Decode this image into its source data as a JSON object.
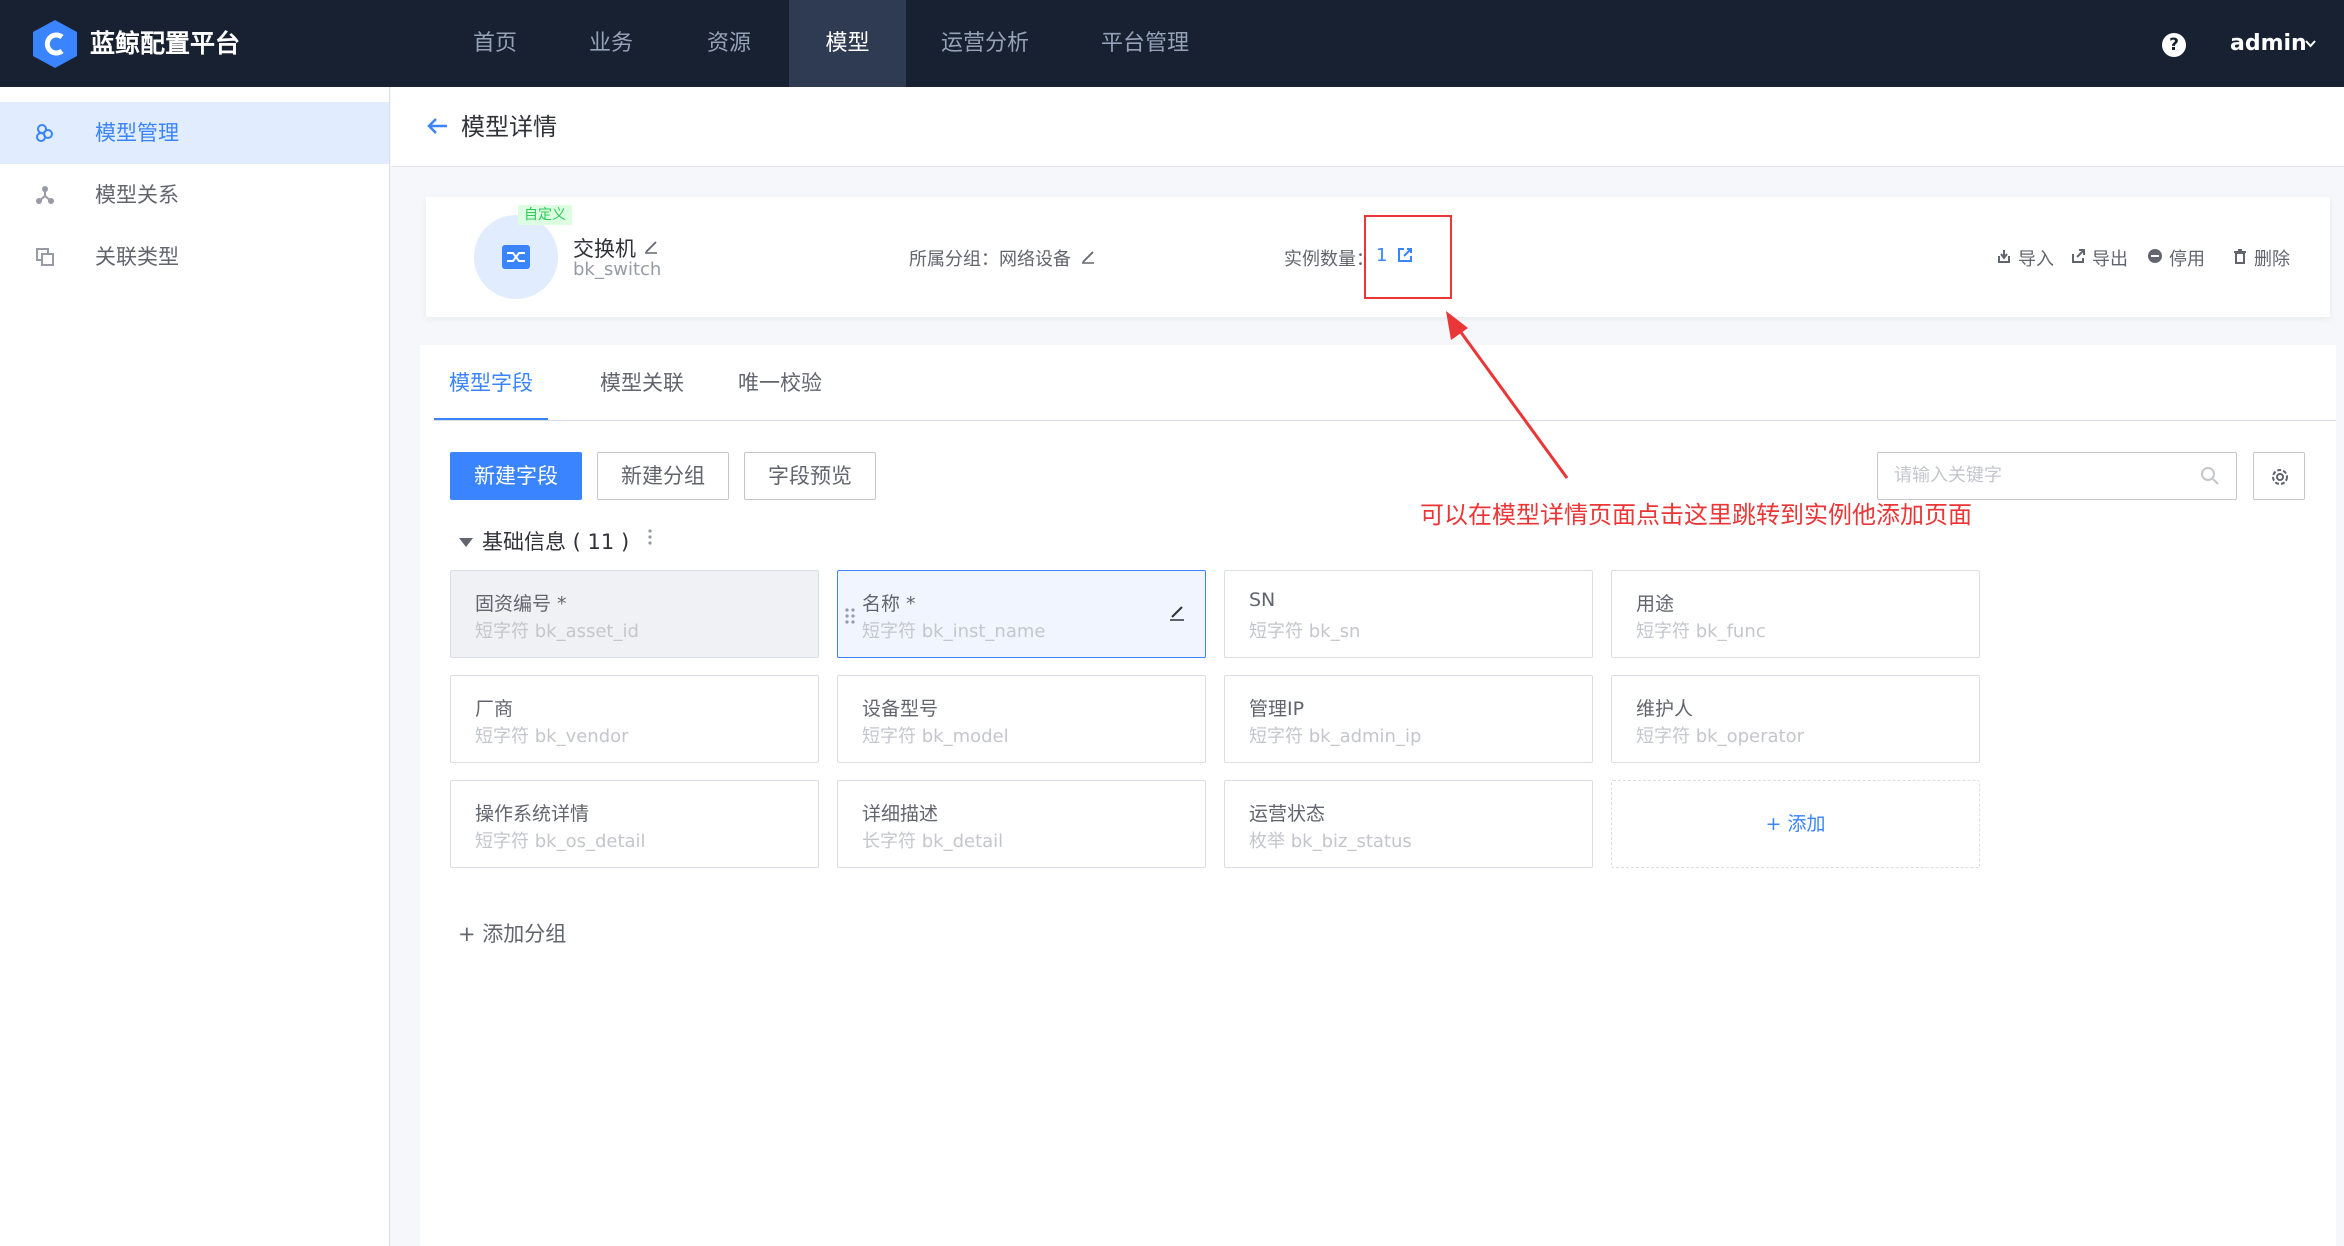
{
  "app": {
    "title": "蓝鲸配置平台"
  },
  "topnav": {
    "items": [
      {
        "label": "首页"
      },
      {
        "label": "业务"
      },
      {
        "label": "资源"
      },
      {
        "label": "模型",
        "active": true
      },
      {
        "label": "运营分析"
      },
      {
        "label": "平台管理"
      }
    ],
    "help_icon": "question-circle-icon",
    "user": "admin"
  },
  "sidebar": {
    "items": [
      {
        "label": "模型管理",
        "icon": "model-management-icon",
        "active": true
      },
      {
        "label": "模型关系",
        "icon": "model-relation-icon"
      },
      {
        "label": "关联类型",
        "icon": "association-type-icon"
      }
    ]
  },
  "header": {
    "title": "模型详情"
  },
  "model": {
    "badge": "自定义",
    "name": "交换机",
    "id": "bk_switch",
    "group_label": "所属分组：网络设备",
    "instance_label": "实例数量：",
    "instance_count": "1",
    "actions": [
      {
        "label": "导入",
        "icon": "import-icon"
      },
      {
        "label": "导出",
        "icon": "export-icon"
      },
      {
        "label": "停用",
        "icon": "disable-icon"
      },
      {
        "label": "删除",
        "icon": "delete-icon"
      }
    ]
  },
  "tabs": [
    {
      "label": "模型字段",
      "active": true
    },
    {
      "label": "模型关联"
    },
    {
      "label": "唯一校验"
    }
  ],
  "toolbar": {
    "new_field": "新建字段",
    "new_group": "新建分组",
    "preview": "字段预览",
    "search_placeholder": "请输入关键字"
  },
  "group": {
    "title": "基础信息 ( 11 )",
    "fields": [
      {
        "name": "固资编号 *",
        "sub": "短字符  bk_asset_id"
      },
      {
        "name": "名称 *",
        "sub": "短字符  bk_inst_name"
      },
      {
        "name": "SN",
        "sub": "短字符  bk_sn"
      },
      {
        "name": "用途",
        "sub": "短字符  bk_func"
      },
      {
        "name": "厂商",
        "sub": "短字符  bk_vendor"
      },
      {
        "name": "设备型号",
        "sub": "短字符  bk_model"
      },
      {
        "name": "管理IP",
        "sub": "短字符  bk_admin_ip"
      },
      {
        "name": "维护人",
        "sub": "短字符  bk_operator"
      },
      {
        "name": "操作系统详情",
        "sub": "短字符  bk_os_detail"
      },
      {
        "name": "详细描述",
        "sub": "长字符  bk_detail"
      },
      {
        "name": "运营状态",
        "sub": "枚举  bk_biz_status"
      }
    ],
    "add_label": "+ 添加"
  },
  "add_group": "添加分组",
  "annotation": "可以在模型详情页面点击这里跳转到实例他添加页面",
  "colors": {
    "primary": "#3a84ff",
    "nav_bg": "#182132",
    "annotation": "#ea3636",
    "badge": "#2dcb56"
  }
}
